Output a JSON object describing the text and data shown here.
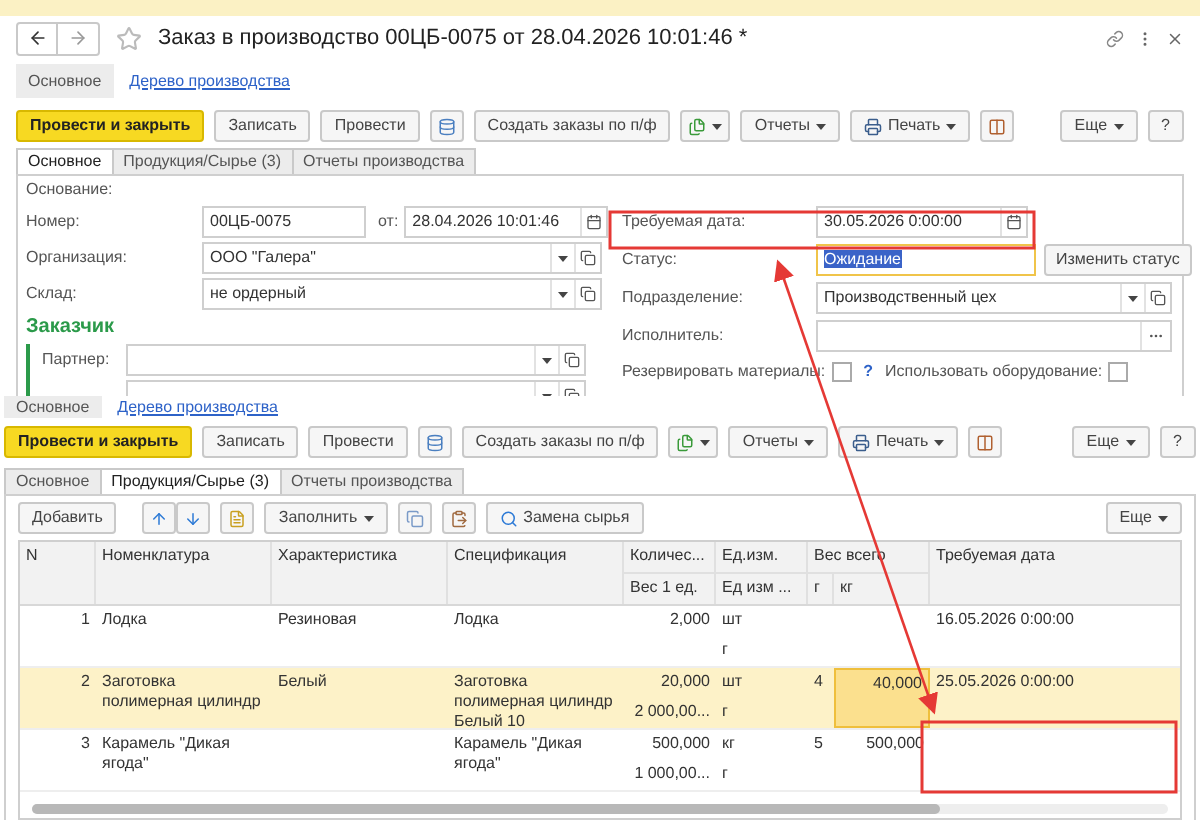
{
  "window": {
    "title": "Заказ в производство 00ЦБ-0075 от 28.04.2026 10:01:46 *"
  },
  "nav": [
    {
      "label": "Основное",
      "selected": true
    },
    {
      "label": "Дерево производства",
      "selected": false
    }
  ],
  "toolbar": {
    "post_and_close": "Провести и закрыть",
    "save": "Записать",
    "post": "Провести",
    "create_orders": "Создать заказы по п/ф",
    "reports": "Отчеты",
    "print": "Печать",
    "more": "Еще",
    "help": "?"
  },
  "tabs": [
    {
      "label": "Основное",
      "selected": true
    },
    {
      "label": "Продукция/Сырье (3)",
      "selected": false
    },
    {
      "label": "Отчеты производства",
      "selected": false
    }
  ],
  "form": {
    "basis_label": "Основание:",
    "number": {
      "label": "Номер:",
      "value": "00ЦБ-0075"
    },
    "date": {
      "label": "от:",
      "value": "28.04.2026 10:01:46"
    },
    "organization": {
      "label": "Организация:",
      "value": "ООО \"Галера\""
    },
    "warehouse": {
      "label": "Склад:",
      "value": "не ордерный"
    },
    "customer_heading": "Заказчик",
    "partner": {
      "label": "Партнер:"
    },
    "required_date": {
      "label": "Требуемая дата:",
      "value": "30.05.2026  0:00:00"
    },
    "status": {
      "label": "Статус:",
      "value": "Ожидание",
      "focused": true
    },
    "change_status": "Изменить статус",
    "department": {
      "label": "Подразделение:",
      "value": "Производственный цех"
    },
    "executor": {
      "label": "Исполнитель:"
    },
    "reserve_materials": {
      "label": "Резервировать материалы:",
      "checked": false
    },
    "help": "?",
    "use_equipment": {
      "label": "Использовать оборудование:",
      "checked": false
    }
  },
  "lower": {
    "nav": [
      {
        "label": "Основное",
        "selected": true
      },
      {
        "label": "Дерево производства",
        "selected": false
      }
    ],
    "toolbar": {
      "post_and_close": "Провести и закрыть",
      "save": "Записать",
      "post": "Провести",
      "create_orders": "Создать заказы по п/ф",
      "reports": "Отчеты",
      "print": "Печать",
      "more": "Еще",
      "help": "?"
    },
    "tabs": [
      {
        "label": "Основное",
        "selected": false
      },
      {
        "label": "Продукция/Сырье (3)",
        "selected": true
      },
      {
        "label": "Отчеты производства",
        "selected": false
      }
    ],
    "table_toolbar": {
      "add": "Добавить",
      "fill": "Заполнить",
      "replace": "Замена сырья",
      "more": "Еще"
    },
    "table": {
      "columns": {
        "n": "N",
        "name": "Номенклатура",
        "characteristic": "Характеристика",
        "specification": "Спецификация",
        "quantity": "Количес...",
        "weight_per_unit": "Вес 1 ед.",
        "unit": "Ед.изм.",
        "weight_unit": "Ед изм ...",
        "total_weight": "Вес всего",
        "g": "г",
        "kg": "кг",
        "required_date": "Требуемая дата"
      },
      "rows": [
        {
          "n": "1",
          "name": "Лодка",
          "characteristic": "Резиновая",
          "specification": "Лодка",
          "quantity": "2,000",
          "unit": "шт",
          "weight_unit": "г",
          "required_date": "16.05.2026 0:00:00",
          "selected": false
        },
        {
          "n": "2",
          "name": "Заготовка полимерная цилиндр",
          "characteristic": "Белый",
          "specification": "Заготовка полимерная цилиндр  Белый 10",
          "quantity": "20,000",
          "weight_per_unit": "2 000,00...",
          "unit": "шт",
          "weight_unit": "г",
          "g": "4",
          "kg": "40,000",
          "required_date": "25.05.2026 0:00:00",
          "selected": true
        },
        {
          "n": "3",
          "name": "Карамель \"Дикая ягода\"",
          "specification": "Карамель \"Дикая ягода\"",
          "quantity": "500,000",
          "weight_per_unit": "1 000,00...",
          "unit": "кг",
          "weight_unit": "г",
          "g": "5",
          "kg": "500,000",
          "selected": false
        }
      ]
    }
  }
}
